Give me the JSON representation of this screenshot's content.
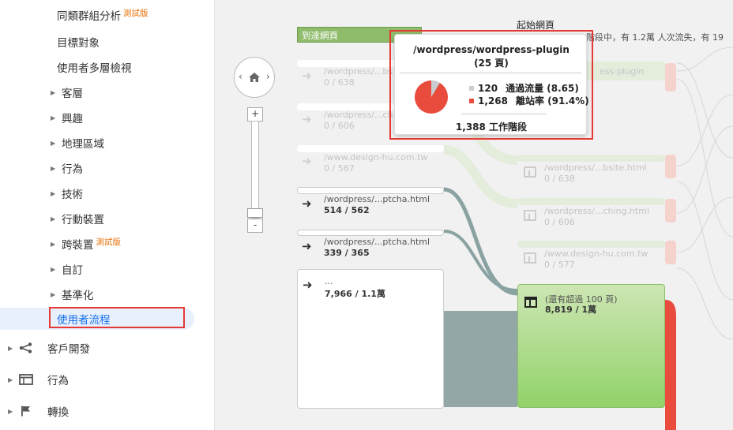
{
  "sidebar": {
    "items": [
      {
        "label": "同類群組分析",
        "beta": "測試版"
      },
      {
        "label": "目標對象"
      },
      {
        "label": "使用者多層檢視"
      },
      {
        "label": "客層"
      },
      {
        "label": "興趣"
      },
      {
        "label": "地理區域"
      },
      {
        "label": "行為"
      },
      {
        "label": "技術"
      },
      {
        "label": "行動裝置"
      },
      {
        "label": "跨裝置",
        "beta": "測試版"
      },
      {
        "label": "自訂"
      },
      {
        "label": "基準化"
      },
      {
        "label": "使用者流程"
      }
    ],
    "sections": [
      {
        "label": "客戶開發",
        "icon": "acquisition-icon"
      },
      {
        "label": "行為",
        "icon": "behavior-icon"
      },
      {
        "label": "轉換",
        "icon": "flag-icon"
      }
    ]
  },
  "flow": {
    "landing_header": "到達網頁",
    "start_header": "起始網頁",
    "start_sub": "階段中，有 1.2萬 人次流失，有 19",
    "left_nodes": [
      {
        "label": "/wordpress/...bs",
        "value": "0 / 638"
      },
      {
        "label": "/wordpress/...ch",
        "value": "0 / 606"
      },
      {
        "label": "/www.design-hu.com.tw",
        "value": "0 / 567"
      },
      {
        "label": "/wordpress/...ptcha.html",
        "value": "514 / 562"
      },
      {
        "label": "/wordpress/...ptcha.html",
        "value": "339 / 365"
      },
      {
        "label": "...",
        "value": "7,966 / 1.1萬"
      }
    ],
    "right_nodes": [
      {
        "label": "ess-plugin",
        "value": ""
      },
      {
        "label": "/wordpress/...bsite.html",
        "value": "0 / 638"
      },
      {
        "label": "/wordpress/...ching.html",
        "value": "0 / 606"
      },
      {
        "label": "/www.design-hu.com.tw",
        "value": "0 / 577"
      },
      {
        "label": "(還有超過 100 頁)",
        "value": "8,819 / 1萬"
      }
    ]
  },
  "tooltip": {
    "title": "/wordpress/wordpress-plugin",
    "pages": "(25 頁)",
    "through_value": "120",
    "through_label": "通過流量 (8.65)",
    "drop_value": "1,268",
    "drop_label": "離站率 (91.4%)",
    "sessions": "1,388 工作階段",
    "through_fraction": 0.0865,
    "colors": {
      "through": "#c9cdd2",
      "drop": "#e94b3c"
    }
  },
  "zoom": {
    "plus": "+",
    "minus": "-"
  }
}
